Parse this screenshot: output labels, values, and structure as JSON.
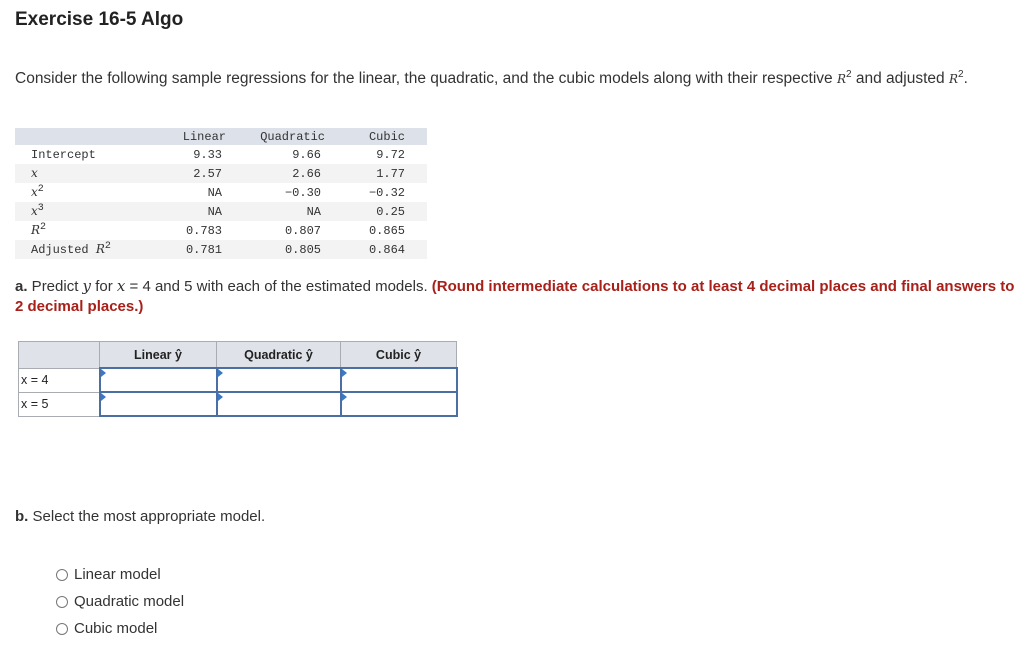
{
  "title": "Exercise 16-5 Algo",
  "intro": {
    "text_before": "Consider the following sample regressions for the linear, the quadratic, and the cubic models along with their respective ",
    "text_middle": " and adjusted ",
    "text_end": ".",
    "r_symbol": "R",
    "sup": "2"
  },
  "regression_table": {
    "headers": [
      "",
      "Linear",
      "Quadratic",
      "Cubic"
    ],
    "rows": [
      {
        "label": "Intercept",
        "sup": "",
        "italic": false,
        "values": [
          "9.33",
          "9.66",
          "9.72"
        ]
      },
      {
        "label": "x",
        "sup": "",
        "italic": true,
        "values": [
          "2.57",
          "2.66",
          "1.77"
        ]
      },
      {
        "label": "x",
        "sup": "2",
        "italic": true,
        "values": [
          "NA",
          "−0.30",
          "−0.32"
        ]
      },
      {
        "label": "x",
        "sup": "3",
        "italic": true,
        "values": [
          "NA",
          "NA",
          "0.25"
        ]
      },
      {
        "label": "R",
        "sup": "2",
        "italic": true,
        "values": [
          "0.783",
          "0.807",
          "0.865"
        ]
      },
      {
        "label": "Adjusted ",
        "label_italic": "R",
        "sup": "2",
        "values": [
          "0.781",
          "0.805",
          "0.864"
        ]
      }
    ]
  },
  "part_a": {
    "prefix": "a.",
    "text1": " Predict ",
    "y": "y",
    "text2": " for ",
    "x": "x",
    "text3": " = 4 and 5 with each of the estimated models. ",
    "instruction": "(Round intermediate calculations to at least 4 decimal places and final answers to 2 decimal places.)"
  },
  "answer_table": {
    "headers": [
      "Linear ŷ",
      "Quadratic ŷ",
      "Cubic ŷ"
    ],
    "rows": [
      {
        "label": "x = 4",
        "values": [
          "",
          "",
          ""
        ]
      },
      {
        "label": "x = 5",
        "values": [
          "",
          "",
          ""
        ]
      }
    ]
  },
  "part_b": {
    "prefix": "b.",
    "text": " Select the most appropriate model.",
    "options": [
      "Linear model",
      "Quadratic model",
      "Cubic model"
    ],
    "selected": null
  },
  "colors": {
    "instruction_red": "#a8201a",
    "input_border": "#4b6fa3",
    "header_bg": "#dde1e9"
  }
}
